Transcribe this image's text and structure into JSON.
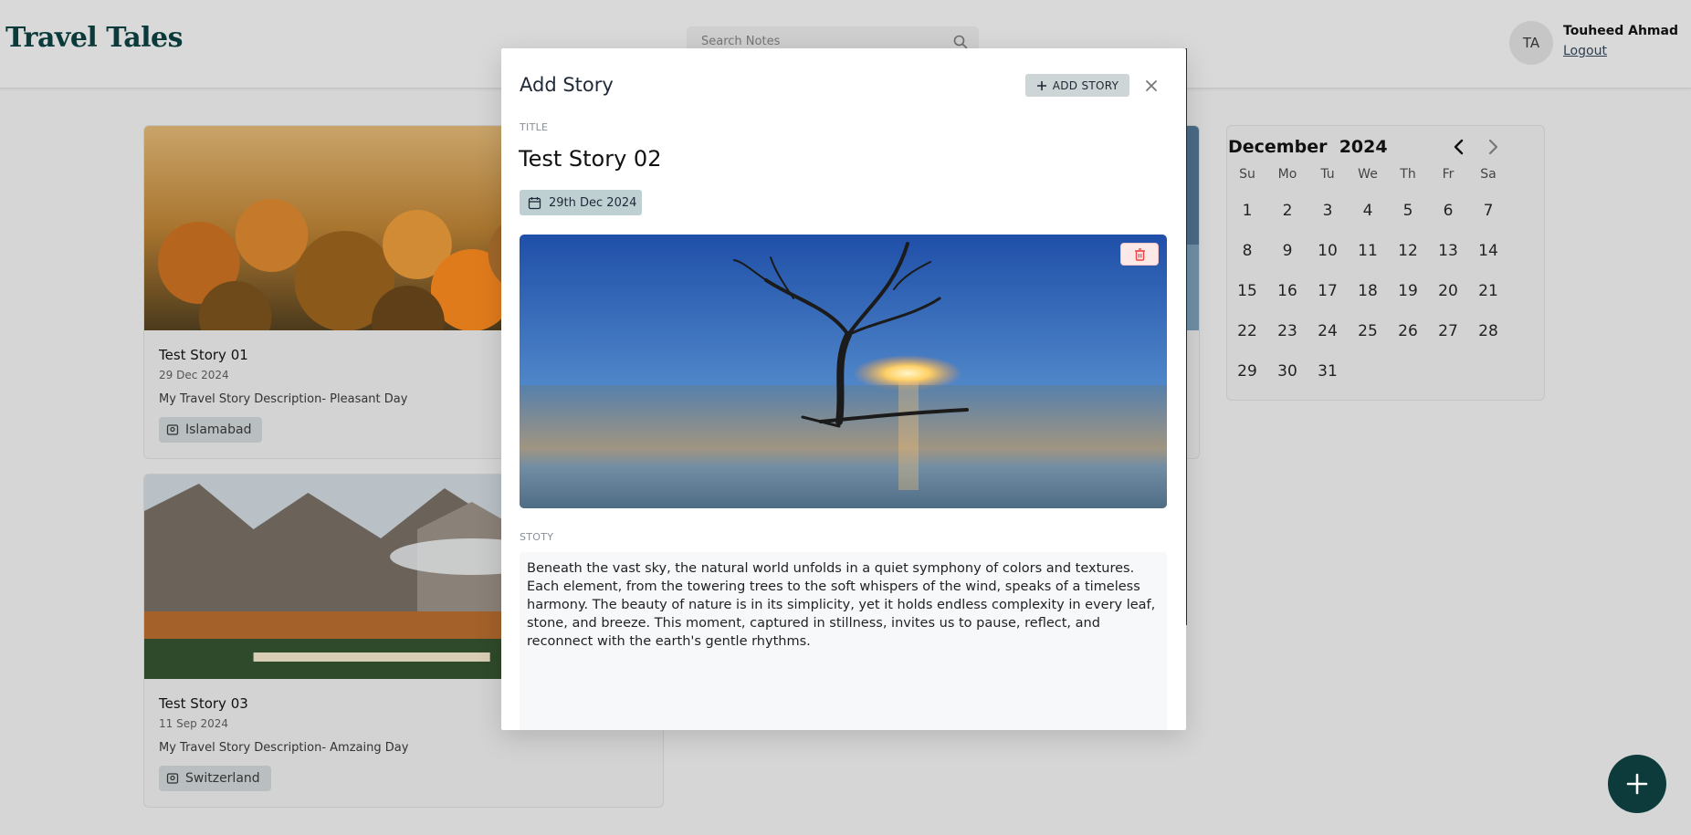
{
  "app": {
    "logo": "Travel Tales",
    "search_placeholder": "Search Notes",
    "user": {
      "initials": "TA",
      "name": "Touheed Ahmad",
      "logout_label": "Logout"
    }
  },
  "stories": [
    {
      "title": "Test Story 01",
      "date": "29 Dec 2024",
      "description": "My Travel Story Description- Pleasant Day",
      "location": "Islamabad"
    },
    {
      "title": "Test Story 03",
      "date": "11 Sep 2024",
      "description": "My Travel Story Description- Amzaing Day",
      "location": "Switzerland"
    }
  ],
  "calendar": {
    "month": "December",
    "year": "2024",
    "weekdays": [
      "Su",
      "Mo",
      "Tu",
      "We",
      "Th",
      "Fr",
      "Sa"
    ],
    "days": [
      "1",
      "2",
      "3",
      "4",
      "5",
      "6",
      "7",
      "8",
      "9",
      "10",
      "11",
      "12",
      "13",
      "14",
      "15",
      "16",
      "17",
      "18",
      "19",
      "20",
      "21",
      "22",
      "23",
      "24",
      "25",
      "26",
      "27",
      "28",
      "29",
      "30",
      "31"
    ]
  },
  "modal": {
    "heading": "Add Story",
    "add_button_label": "ADD STORY",
    "title_label": "TITLE",
    "title_value": "Test Story 02",
    "date_value": "29th Dec 2024",
    "story_label": "STOTY",
    "story_text": "Beneath the vast sky, the natural world unfolds in a quiet symphony of colors and textures. Each element, from the towering trees to the soft whispers of the wind, speaks of a timeless harmony. The beauty of nature is in its simplicity, yet it holds endless complexity in every leaf, stone, and breeze. This moment, captured in stillness, invites us to pause, reflect, and reconnect with the earth's gentle rhythms."
  },
  "colors": {
    "brand": "#0d3b3b",
    "date_chip": "#bfd0d3",
    "delete": "#ef4444"
  },
  "icons": [
    "search-icon",
    "location-icon",
    "chevron-left-icon",
    "chevron-right-icon",
    "plus-icon",
    "close-icon",
    "calendar-icon",
    "trash-icon"
  ]
}
